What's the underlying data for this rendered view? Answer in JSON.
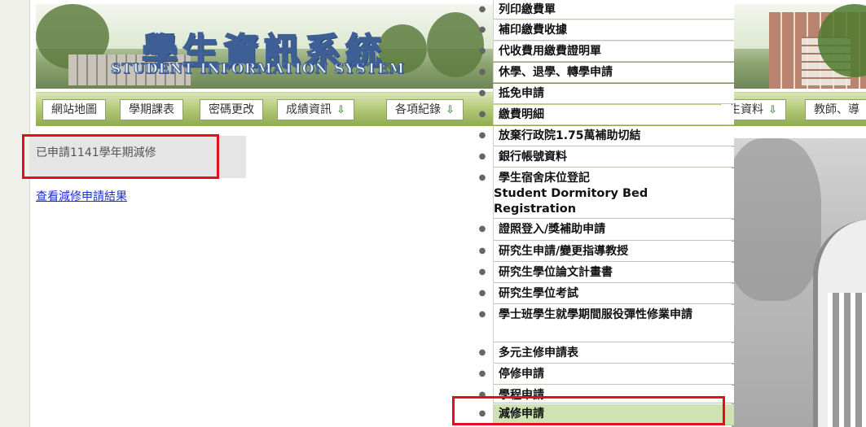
{
  "banner": {
    "title": "學生資訊系統",
    "subtitle": "STUDENT INFORMATION SYSTEM"
  },
  "nav": {
    "items": [
      {
        "label": "網站地圖",
        "arrow": false
      },
      {
        "label": "學期課表",
        "arrow": false
      },
      {
        "label": "密碼更改",
        "arrow": false
      },
      {
        "label": "成績資訊",
        "arrow": true
      },
      {
        "label": "各項紀錄",
        "arrow": true
      },
      {
        "label": "生資料",
        "arrow": true
      },
      {
        "label": "教師、導",
        "arrow": false
      }
    ],
    "arrow_glyph": "⇩"
  },
  "main": {
    "status_text": "已申請1141學年期減修",
    "result_link": "查看減修申請結果"
  },
  "menu": {
    "bullet_glyph": "●",
    "items": [
      {
        "label": "列印繳費單"
      },
      {
        "label": "補印繳費收據"
      },
      {
        "label": "代收費用繳費證明單"
      },
      {
        "label": "休學、退學、轉學申請"
      },
      {
        "label": "抵免申請"
      },
      {
        "label": "繳費明細"
      },
      {
        "label": "放棄行政院1.75萬補助切結"
      },
      {
        "label": "銀行帳號資料"
      },
      {
        "label": "學生宿舍床位登記",
        "label2": "Student Dormitory Bed Registration"
      },
      {
        "label": "證照登入/獎補助申請"
      },
      {
        "label": "研究生申請/變更指導教授"
      },
      {
        "label": "研究生學位論文計畫書"
      },
      {
        "label": "研究生學位考試"
      },
      {
        "label": "學士班學生就學期間服役彈性修業申請"
      },
      {
        "label": "多元主修申請表"
      },
      {
        "label": "停修申請"
      },
      {
        "label": "學程申請"
      },
      {
        "label": "減修申請",
        "active": true
      }
    ]
  },
  "colors": {
    "highlight": "#e3101b",
    "nav_green": "#aec572",
    "link_blue": "#1f2fd0",
    "menu_active": "#cfe2b2"
  }
}
